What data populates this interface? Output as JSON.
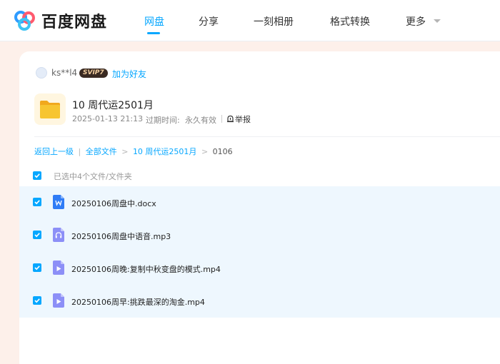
{
  "header": {
    "brand": "百度网盘",
    "nav": [
      {
        "label": "网盘",
        "active": true
      },
      {
        "label": "分享",
        "active": false
      },
      {
        "label": "一刻相册",
        "active": false
      },
      {
        "label": "格式转换",
        "active": false
      },
      {
        "label": "更多",
        "active": false
      }
    ]
  },
  "sharer": {
    "username": "ks**l4",
    "badge": "SVIP7",
    "add_friend": "加为好友"
  },
  "share": {
    "title": "10 周代运2501月",
    "date": "2025-01-13 21:13",
    "expire_label": "过期时间:",
    "expire_value": "永久有效",
    "report": "举报"
  },
  "breadcrumb": {
    "back": "返回上一级",
    "all_files": "全部文件",
    "folder": "10 周代运2501月",
    "current": "0106"
  },
  "selection": {
    "label": "已选中4个文件/文件夹"
  },
  "files": [
    {
      "name": "20250106周盘中.docx",
      "type": "doc"
    },
    {
      "name": "20250106周盘中语音.mp3",
      "type": "audio"
    },
    {
      "name": "20250106周晚:复制中秋变盘的模式.mp4",
      "type": "video"
    },
    {
      "name": "20250106周早:挑跌最深的淘金.mp4",
      "type": "video"
    }
  ],
  "colors": {
    "accent": "#06a7ff",
    "doc_icon": "#2f7cf6",
    "media_icon": "#8c8ff7",
    "folder": "#f7c531"
  }
}
